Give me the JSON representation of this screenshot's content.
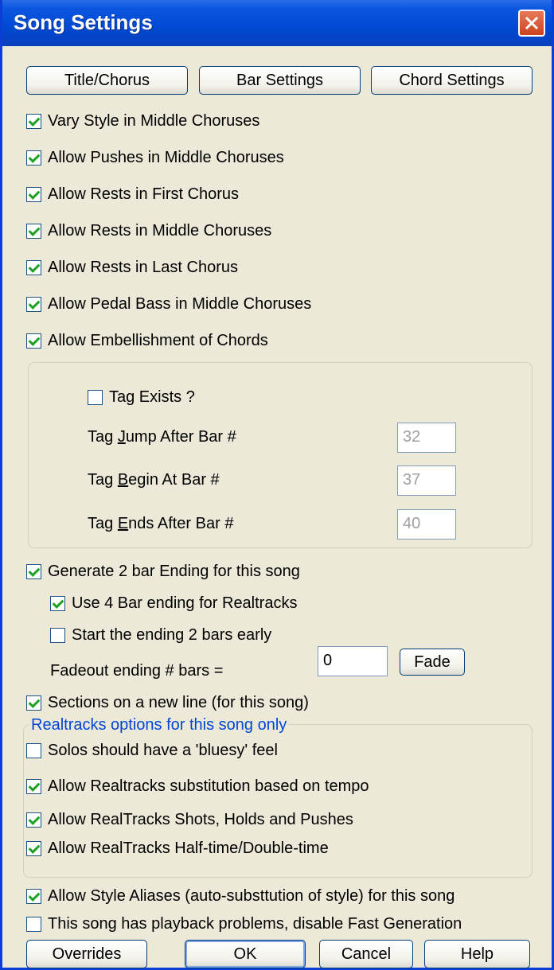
{
  "window": {
    "title": "Song Settings"
  },
  "top_buttons": [
    "Title/Chorus",
    "Bar Settings",
    "Chord Settings"
  ],
  "checkboxes_main": [
    {
      "label": "Vary Style in Middle Choruses",
      "checked": true
    },
    {
      "label": "Allow Pushes in Middle Choruses",
      "checked": true
    },
    {
      "label": "Allow Rests in First Chorus",
      "checked": true
    },
    {
      "label": "Allow Rests in Middle Choruses",
      "checked": true
    },
    {
      "label": "Allow Rests in Last Chorus",
      "checked": true
    },
    {
      "label": "Allow Pedal Bass in Middle Choruses",
      "checked": true
    },
    {
      "label": "Allow Embellishment of Chords",
      "checked": true
    }
  ],
  "tag": {
    "exists_label": "Tag Exists ?",
    "exists_checked": false,
    "jump_pre": "Tag ",
    "jump_key": "J",
    "jump_post": "ump After Bar #",
    "jump_value": "32",
    "begin_pre": "Tag ",
    "begin_key": "B",
    "begin_post": "egin At Bar #",
    "begin_value": "37",
    "ends_pre": "Tag ",
    "ends_key": "E",
    "ends_post": "nds After Bar #",
    "ends_value": "40"
  },
  "ending": {
    "generate_label": "Generate 2 bar Ending for this song",
    "generate_checked": true,
    "use4_label": "Use 4 Bar ending for Realtracks",
    "use4_checked": true,
    "early_label": "Start the ending 2 bars early",
    "early_checked": false,
    "fadeout_label": "Fadeout ending # bars =",
    "fadeout_value": "0",
    "fade_button": "Fade"
  },
  "sections": {
    "label": "Sections on a new line (for this song)",
    "checked": true
  },
  "realtracks": {
    "legend": "Realtracks options for this song only",
    "items": [
      {
        "label": "Solos should have a 'bluesy' feel",
        "checked": false
      },
      {
        "label": "Allow Realtracks substitution based on tempo",
        "checked": true
      },
      {
        "label": "Allow RealTracks Shots, Holds and Pushes",
        "checked": true
      },
      {
        "label": "Allow RealTracks Half-time/Double-time",
        "checked": true
      }
    ]
  },
  "bottom_checks": [
    {
      "label": "Allow Style Aliases (auto-substtution of style) for this song",
      "checked": true
    },
    {
      "label": "This song has playback problems, disable Fast Generation",
      "checked": false
    }
  ],
  "bottom_buttons": [
    "Overrides",
    "OK",
    "Cancel",
    "Help"
  ],
  "colors": {
    "titlebar": "#0149d2",
    "dialog_bg": "#ece9d8",
    "check": "#21a121",
    "legend": "#0046d5"
  }
}
